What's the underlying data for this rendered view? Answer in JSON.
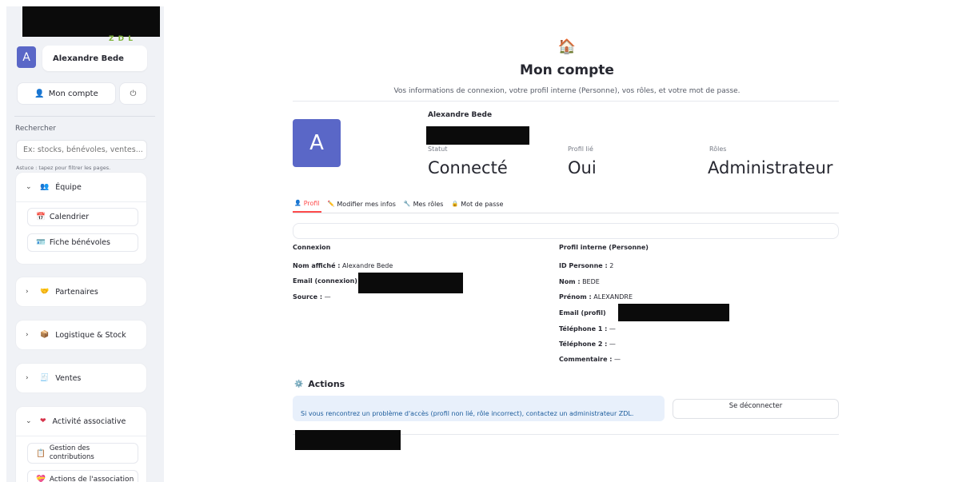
{
  "sidebar": {
    "logo_peek": "Z D L",
    "user": {
      "initial": "A",
      "name": "Alexandre Bede"
    },
    "account_button": {
      "icon": "person-icon",
      "label": "Mon compte"
    },
    "power_button": {
      "icon": "power-icon",
      "label": "⏻"
    },
    "search": {
      "label": "Rechercher",
      "placeholder": "Ex: stocks, bénévoles, ventes...",
      "hint": "Astuce : tapez pour filtrer les pages."
    },
    "groups": [
      {
        "label": "Équipe",
        "emoji": "👥",
        "expanded": true,
        "chevron": "⌄",
        "items": [
          {
            "icon": "calendar-icon",
            "glyph": "📅",
            "label": "Calendrier"
          },
          {
            "icon": "card-icon",
            "glyph": "🪪",
            "label": "Fiche bénévoles"
          }
        ]
      },
      {
        "label": "Partenaires",
        "emoji": "🤝",
        "expanded": false,
        "chevron": "›"
      },
      {
        "label": "Logistique & Stock",
        "emoji": "📦",
        "expanded": false,
        "chevron": "›"
      },
      {
        "label": "Ventes",
        "emoji": "🧾",
        "expanded": false,
        "chevron": "›"
      },
      {
        "label": "Activité associative",
        "emoji": "❤",
        "expanded": true,
        "chevron": "⌄",
        "items": [
          {
            "icon": "clipboard-icon",
            "glyph": "📋",
            "label": "Gestion des contributions"
          },
          {
            "icon": "heart-hand-icon",
            "glyph": "💝",
            "label": "Actions de l'association"
          }
        ]
      }
    ]
  },
  "header": {
    "icon": "🏠",
    "title": "Mon compte",
    "subtitle": "Vos informations de connexion, votre profil interne (Personne), vos rôles, et votre mot de passe."
  },
  "profile": {
    "initial": "A",
    "name": "Alexandre Bede",
    "metrics": [
      {
        "label": "Statut",
        "value": "Connecté"
      },
      {
        "label": "Profil lié",
        "value": "Oui"
      },
      {
        "label": "Rôles",
        "value": "Administrateur"
      }
    ]
  },
  "tabs": [
    {
      "icon": "👤",
      "label": "Profil",
      "active": true
    },
    {
      "icon": "✏️",
      "label": "Modifier mes infos",
      "active": false
    },
    {
      "icon": "🔧",
      "label": "Mes rôles",
      "active": false
    },
    {
      "icon": "🔒",
      "label": "Mot de passe",
      "active": false
    }
  ],
  "connexion": {
    "title": "Connexion",
    "rows": [
      {
        "key": "Nom affiché :",
        "value": "Alexandre Bede"
      },
      {
        "key": "Email (connexion) :",
        "value": ""
      },
      {
        "key": "Source :",
        "value": "—"
      }
    ]
  },
  "profil_interne": {
    "title": "Profil interne (Personne)",
    "rows": [
      {
        "key": "ID Personne :",
        "value": "2"
      },
      {
        "key": "Nom :",
        "value": "BEDE"
      },
      {
        "key": "Prénom :",
        "value": "ALEXANDRE"
      },
      {
        "key": "Email (profil)",
        "value": ""
      },
      {
        "key": "Téléphone 1 :",
        "value": "—"
      },
      {
        "key": "Téléphone 2 :",
        "value": "—"
      },
      {
        "key": "Commentaire :",
        "value": "—"
      }
    ]
  },
  "actions": {
    "icon": "⚙️",
    "title": "Actions",
    "info": "Si vous rencontrez un problème d'accès (profil non lié, rôle incorrect), contactez un administrateur ZDL.",
    "logout_label": "Se déconnecter"
  },
  "colors": {
    "accent": "#ff4b4b",
    "avatar": "#5a67c7",
    "sidebar_bg": "#f0f2f6",
    "info_bg": "#e8f0fb",
    "info_text": "#1c5c9c"
  }
}
